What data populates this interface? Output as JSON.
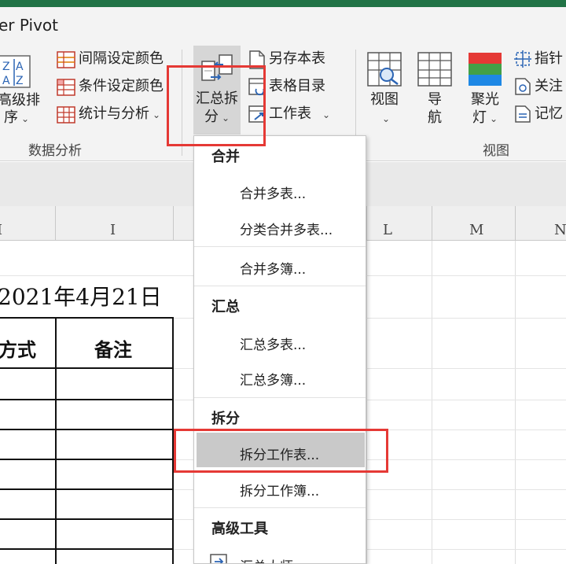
{
  "window": {
    "title_fragment": "er Pivot"
  },
  "ribbon": {
    "sort_group": {
      "label_line1": "高级排",
      "label_line2": "序"
    },
    "analysis_items": [
      {
        "label": "间隔设定颜色"
      },
      {
        "label": "条件设定颜色"
      },
      {
        "label": "统计与分析"
      }
    ],
    "analysis_group_label": "数据分析",
    "summarize_split": {
      "line1": "汇总拆",
      "line2": "分"
    },
    "sheet_items": [
      {
        "label": "另存本表"
      },
      {
        "label": "表格目录"
      },
      {
        "label": "工作表"
      }
    ],
    "view_buttons": [
      {
        "line1": "视图",
        "line2": ""
      },
      {
        "line1": "导",
        "line2": "航"
      },
      {
        "line1": "聚光",
        "line2": "灯"
      }
    ],
    "view_group_label": "视图",
    "right_items": [
      {
        "label": "指针"
      },
      {
        "label": "关注"
      },
      {
        "label": "记忆"
      }
    ]
  },
  "columns": {
    "left_cut": "I",
    "i": "I",
    "l": "L",
    "m": "M",
    "n": "N"
  },
  "sheet": {
    "date_text": "2021年4月21日",
    "table_headers": {
      "method": "方式",
      "note": "备注"
    }
  },
  "dropdown": {
    "sections": [
      {
        "title": "合并",
        "items": [
          "合并多表...",
          "分类合并多表...",
          "合并多簿..."
        ]
      },
      {
        "title": "汇总",
        "items": [
          "汇总多表...",
          "汇总多簿..."
        ]
      },
      {
        "title": "拆分",
        "items": [
          "拆分工作表...",
          "拆分工作簿..."
        ]
      },
      {
        "title": "高级工具",
        "items": [
          "汇总大师"
        ]
      }
    ],
    "highlighted_item": "拆分工作表..."
  },
  "colors": {
    "excel_green": "#217346",
    "highlight_red": "#e53935",
    "menu_hover": "#c9c9c9"
  },
  "icons": {
    "sort": "sort-az-icon",
    "interval_color": "grid-color-icon",
    "condition_color": "grid-condition-icon",
    "stats": "grid-stats-icon",
    "summarize_split": "summarize-split-icon",
    "save_sheet": "save-sheet-icon",
    "table_toc": "table-toc-icon",
    "worksheet": "worksheet-icon",
    "view": "view-grid-icon",
    "nav": "nav-grid-icon",
    "spotlight": "spotlight-icon"
  }
}
